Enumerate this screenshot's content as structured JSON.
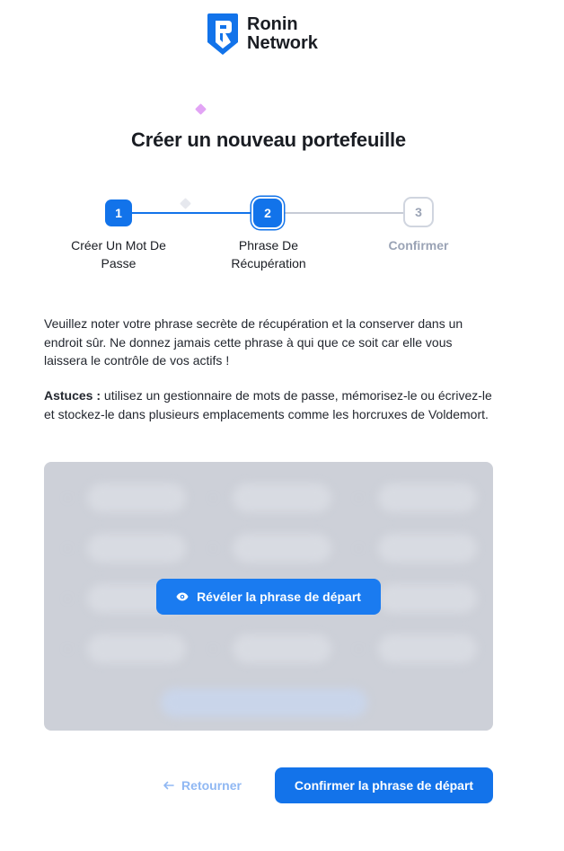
{
  "brand": {
    "line1": "Ronin",
    "line2": "Network",
    "accent": "#1273ea"
  },
  "page_title": "Créer un nouveau portefeuille",
  "stepper": {
    "steps": [
      {
        "number": "1",
        "label": "Créer Un Mot De Passe",
        "state": "completed"
      },
      {
        "number": "2",
        "label": "Phrase De Récupération",
        "state": "active"
      },
      {
        "number": "3",
        "label": "Confirmer",
        "state": "pending"
      }
    ]
  },
  "instructions": "Veuillez noter votre phrase secrète de récupération et la conserver dans un endroit sûr. Ne donnez jamais cette phrase à qui que ce soit car elle vous laissera le contrôle de vos actifs !",
  "tips": {
    "label": "Astuces :",
    "text": " utilisez un gestionnaire de mots de passe, mémorisez-le ou écrivez-le et stockez-le dans plusieurs emplacements comme les horcruxes de Voldemort."
  },
  "phrase_panel": {
    "reveal_label": "Révéler la phrase de départ",
    "reveal_icon": "eye-icon"
  },
  "actions": {
    "back_label": "Retourner",
    "back_icon": "arrow-left-icon",
    "confirm_label": "Confirmer la phrase de départ"
  }
}
